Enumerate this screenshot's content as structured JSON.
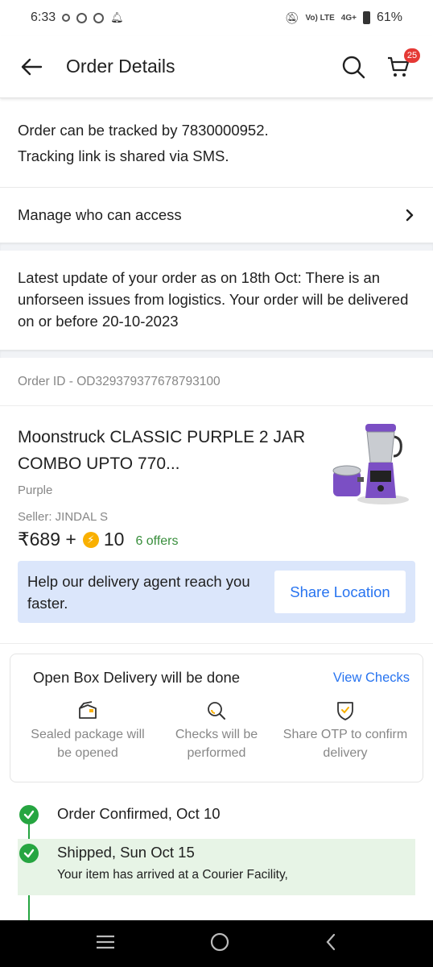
{
  "status_bar": {
    "time": "6:33",
    "network": "4G+",
    "volte": "Vo) LTE",
    "battery": "61%"
  },
  "header": {
    "title": "Order Details",
    "cart_count": "25"
  },
  "tracking": {
    "line1": "Order can be tracked by 7830000952.",
    "line2": "Tracking link is shared via SMS."
  },
  "manage": {
    "label": "Manage who can access"
  },
  "update": {
    "text": "Latest update of your order as on 18th Oct: There is an unforseen issues from logistics. Your order will be delivered on or before 20-10-2023"
  },
  "order": {
    "id_label": "Order ID - OD329379377678793100"
  },
  "product": {
    "name": "Moonstruck CLASSIC PURPLE 2 JAR COMBO UPTO 770...",
    "variant": "Purple",
    "seller": "Seller: JINDAL S",
    "price": "₹689 +",
    "coins": "10",
    "offers": "6 offers"
  },
  "delivery_help": {
    "text": "Help our delivery agent reach you faster.",
    "button": "Share Location"
  },
  "open_box": {
    "title": "Open Box Delivery will be done",
    "link": "View Checks",
    "items": [
      {
        "label": "Sealed package will be opened",
        "icon": "box-icon"
      },
      {
        "label": "Checks will be performed",
        "icon": "magnifier-icon"
      },
      {
        "label": "Share OTP to confirm delivery",
        "icon": "shield-check-icon"
      }
    ]
  },
  "timeline": [
    {
      "title": "Order Confirmed, Oct 10"
    },
    {
      "title": "Shipped, Sun Oct 15",
      "sub": "Your item has arrived at a Courier Facility,"
    }
  ],
  "colors": {
    "accent": "#2874f0",
    "success": "#26a541",
    "badge": "#e53935",
    "help_bg": "#dbe6fb"
  }
}
